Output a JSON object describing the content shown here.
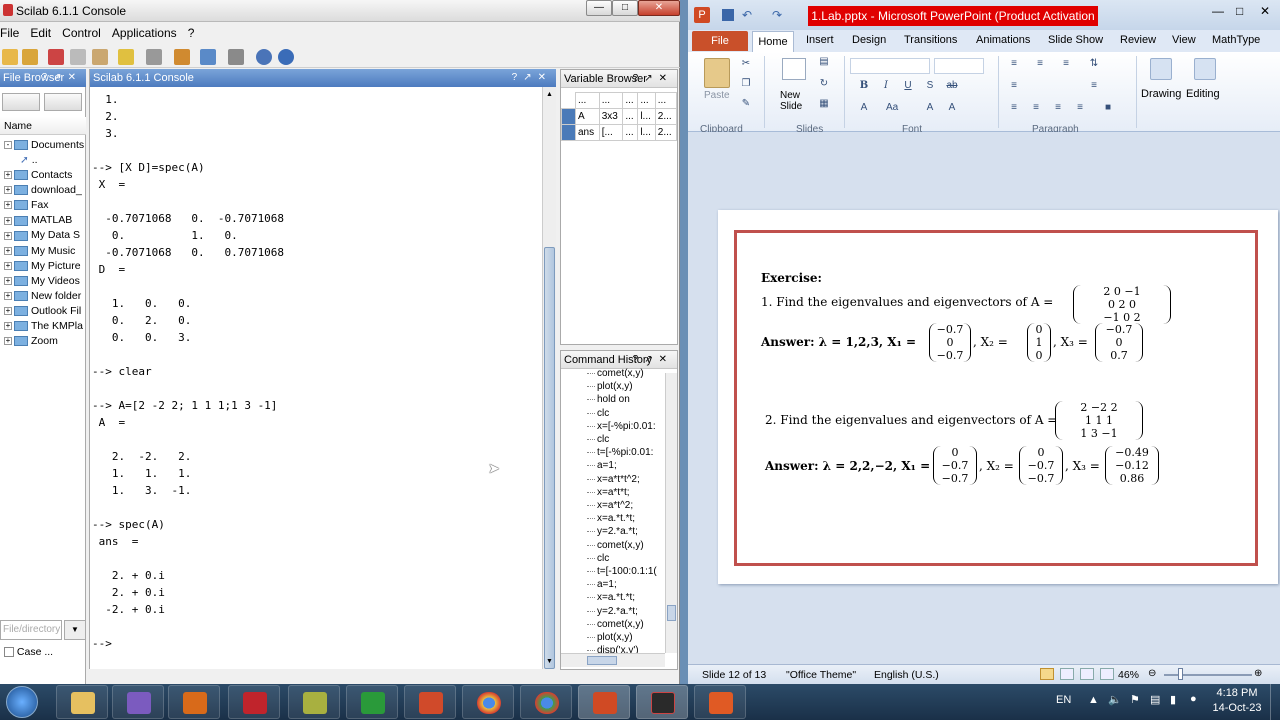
{
  "scilab": {
    "title": "Scilab 6.1.1 Console",
    "menu": [
      "File",
      "Edit",
      "Control",
      "Applications",
      "?"
    ],
    "file_browser": {
      "header": "File Browser",
      "column": "Name",
      "root": "Documents",
      "parent": "..",
      "items": [
        "Contacts",
        "download_",
        "Fax",
        "MATLAB",
        "My Data S",
        "My Music",
        "My Picture",
        "My Videos",
        "New folder",
        "Outlook Fil",
        "The KMPla",
        "Zoom"
      ],
      "filter_placeholder": "File/directory",
      "case_label": "Case ..."
    },
    "console": {
      "header": "Scilab 6.1.1 Console",
      "lines": [
        "  1.",
        "  2.",
        "  3.",
        "",
        "--> [X D]=spec(A)",
        " X  =",
        "",
        "  -0.7071068   0.  -0.7071068",
        "   0.          1.   0.",
        "  -0.7071068   0.   0.7071068",
        " D  =",
        "",
        "   1.   0.   0.",
        "   0.   2.   0.",
        "   0.   0.   3.",
        "",
        "--> clear",
        "",
        "--> A=[2 -2 2; 1 1 1;1 3 -1]",
        " A  =",
        "",
        "   2.  -2.   2.",
        "   1.   1.   1.",
        "   1.   3.  -1.",
        "",
        "--> spec(A)",
        " ans  =",
        "",
        "   2. + 0.i",
        "   2. + 0.i",
        "  -2. + 0.i",
        "",
        "-->"
      ]
    },
    "variable_browser": {
      "header": "Variable Browser",
      "columns": [
        "...",
        "...",
        "...",
        "...",
        "..."
      ],
      "rows": [
        [
          "A",
          "3x3",
          "...",
          "l...",
          "2..."
        ],
        [
          "ans",
          "[...",
          "...",
          "l...",
          "2..."
        ]
      ]
    },
    "command_history": {
      "header": "Command History",
      "items": [
        "comet(x,y)",
        "plot(x,y)",
        "hold on",
        "clc",
        "x=[-%pi:0.01:",
        "clc",
        "t=[-%pi:0.01:",
        "a=1;",
        "x=a*t*t^2;",
        "x=a*t*t;",
        "x=a*t^2;",
        "x=a.*t.*t;",
        "y=2.*a.*t;",
        "comet(x,y)",
        "clc",
        "t=[-100:0.1:1(",
        "a=1;",
        "x=a.*t.*t;",
        "y=2.*a.*t;",
        "comet(x,y)",
        "plot(x,y)",
        "disp('x,y')"
      ]
    }
  },
  "ppt": {
    "title": "1.Lab.pptx - Microsoft PowerPoint (Product Activation Failed)",
    "tabs": [
      "File",
      "Home",
      "Insert",
      "Design",
      "Transitions",
      "Animations",
      "Slide Show",
      "Review",
      "View",
      "MathType"
    ],
    "ribbon": {
      "paste": "Paste",
      "new_slide": "New Slide",
      "drawing": "Drawing",
      "editing": "Editing",
      "groups": [
        "Clipboard",
        "Slides",
        "Font",
        "Paragraph"
      ]
    },
    "slide": {
      "exercise": "Exercise:",
      "q1": "1. Find the eigenvalues and eigenvectors of A =",
      "q1_matrix": [
        "2   0   −1",
        "0   2   0",
        "−1   0   2"
      ],
      "a1_prefix": "Answer: λ = 1,2,3,  X₁ =",
      "a1_x1": [
        "−0.7",
        "0",
        "−0.7"
      ],
      "a1_x2_label": ", X₂ =",
      "a1_x2": [
        "0",
        "1",
        "0"
      ],
      "a1_x3_label": ", X₃ =",
      "a1_x3": [
        "−0.7",
        "0",
        "0.7"
      ],
      "q2": "2. Find the eigenvalues and eigenvectors of A =",
      "q2_matrix": [
        "2   −2   2",
        "1   1   1",
        "1   3   −1"
      ],
      "a2_prefix": "Answer: λ = 2,2,−2,  X₁ =",
      "a2_x1": [
        "0",
        "−0.7",
        "−0.7"
      ],
      "a2_x2_label": ", X₂ =",
      "a2_x2": [
        "0",
        "−0.7",
        "−0.7"
      ],
      "a2_x3_label": ", X₃ =",
      "a2_x3": [
        "−0.49",
        "−0.12",
        "0.86"
      ]
    },
    "status": {
      "slide": "Slide 12 of 13",
      "theme": "\"Office Theme\"",
      "language": "English (U.S.)",
      "zoom": "46%"
    }
  },
  "taskbar": {
    "lang": "EN",
    "time": "4:18 PM",
    "date": "14-Oct-23"
  }
}
